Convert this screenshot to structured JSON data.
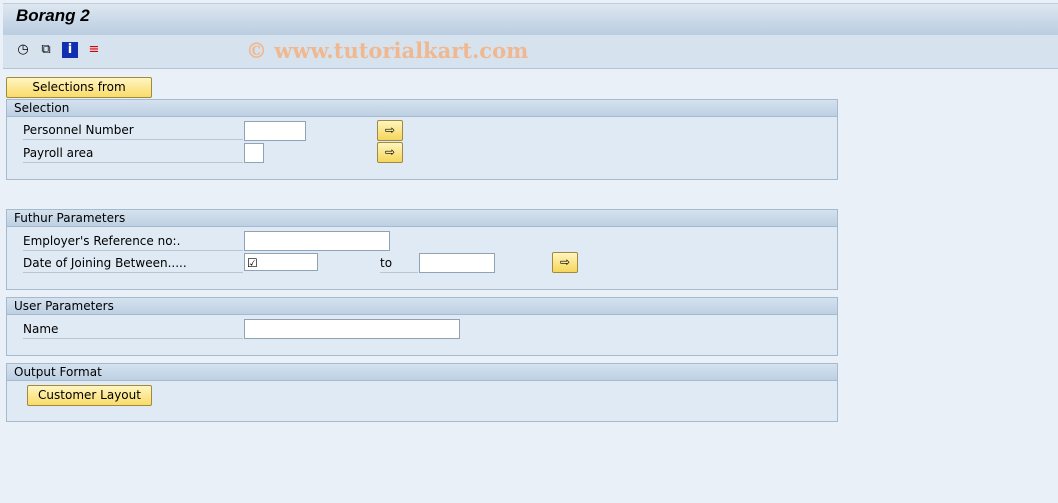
{
  "title": "Borang 2",
  "watermark": "© www.tutorialkart.com",
  "toolbar": {
    "icons": [
      "execute-clock-icon",
      "copy-variant-icon",
      "info-icon",
      "layout-icon"
    ]
  },
  "selections_from": "Selections from",
  "selection": {
    "header": "Selection",
    "personnel_number": "Personnel Number",
    "payroll_area": "Payroll area"
  },
  "further": {
    "header": "Futhur Parameters",
    "employer_ref": "Employer's Reference no:.",
    "date_joining": "Date of Joining Between.....",
    "to": "to",
    "date_from_value": "☑"
  },
  "user": {
    "header": "User Parameters",
    "name": "Name"
  },
  "output": {
    "header": "Output Format",
    "customer_layout": "Customer Layout"
  }
}
